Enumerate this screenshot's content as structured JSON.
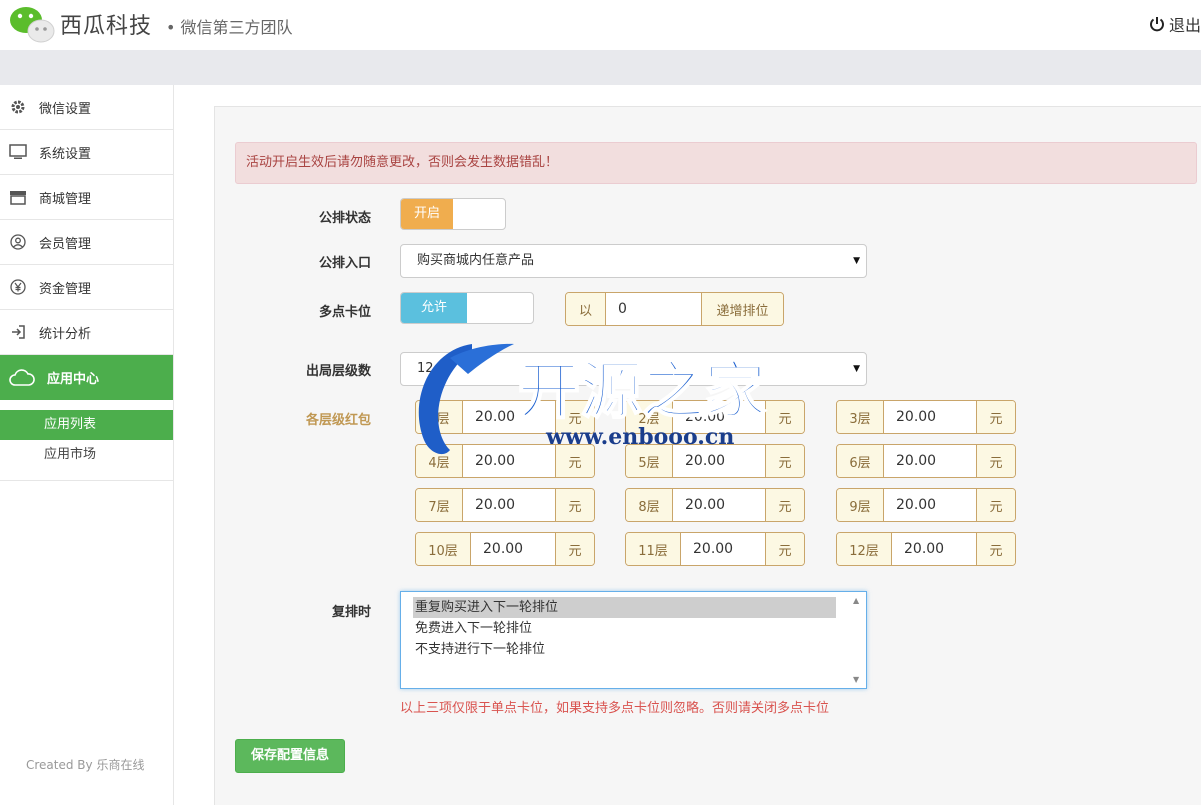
{
  "header": {
    "brand": "西瓜科技",
    "subtitle": "• 微信第三方团队",
    "logout_label": "退出"
  },
  "sidebar": {
    "items": [
      {
        "label": "微信设置",
        "icon": "gear-icon"
      },
      {
        "label": "系统设置",
        "icon": "monitor-icon"
      },
      {
        "label": "商城管理",
        "icon": "store-icon"
      },
      {
        "label": "会员管理",
        "icon": "user-icon"
      },
      {
        "label": "资金管理",
        "icon": "yen-icon"
      },
      {
        "label": "统计分析",
        "icon": "sign-in-icon"
      },
      {
        "label": "应用中心",
        "icon": "cloud-icon",
        "active": true
      }
    ],
    "subitems": [
      {
        "label": "应用列表",
        "active": true
      },
      {
        "label": "应用市场"
      }
    ],
    "footer": "Created By 乐商在线"
  },
  "alert": "活动开启生效后请勿随意更改，否则会发生数据错乱！",
  "form": {
    "status_label": "公排状态",
    "status_value": "开启",
    "entry_label": "公排入口",
    "entry_value": "购买商城内任意产品",
    "multi_label": "多点卡位",
    "multi_value": "允许",
    "multi_prefix": "以",
    "multi_input": "0",
    "multi_suffix": "递增排位",
    "levels_label": "出局层级数",
    "levels_value": "12",
    "layers_label": "各层级红包",
    "layers": [
      {
        "name": "1层",
        "value": "20.00",
        "unit": "元"
      },
      {
        "name": "2层",
        "value": "20.00",
        "unit": "元"
      },
      {
        "name": "3层",
        "value": "20.00",
        "unit": "元"
      },
      {
        "name": "4层",
        "value": "20.00",
        "unit": "元"
      },
      {
        "name": "5层",
        "value": "20.00",
        "unit": "元"
      },
      {
        "name": "6层",
        "value": "20.00",
        "unit": "元"
      },
      {
        "name": "7层",
        "value": "20.00",
        "unit": "元"
      },
      {
        "name": "8层",
        "value": "20.00",
        "unit": "元"
      },
      {
        "name": "9层",
        "value": "20.00",
        "unit": "元"
      },
      {
        "name": "10层",
        "value": "20.00",
        "unit": "元"
      },
      {
        "name": "11层",
        "value": "20.00",
        "unit": "元"
      },
      {
        "name": "12层",
        "value": "20.00",
        "unit": "元"
      }
    ],
    "repeat_label": "复排时",
    "repeat_options": [
      "重复购买进入下一轮排位",
      "免费进入下一轮排位",
      "不支持进行下一轮排位"
    ],
    "note": "以上三项仅限于单点卡位，如果支持多点卡位则忽略。否则请关闭多点卡位",
    "save_label": "保存配置信息"
  },
  "watermark": {
    "title": "开源之家",
    "url": "www.enbooo.cn"
  },
  "colors": {
    "green": "#4cae4c",
    "orange_toggle": "#f0ad4e",
    "blue_toggle": "#5bc0de",
    "alert_bg": "#f2dede",
    "alert_text": "#a94442",
    "note_red": "#d9534f"
  }
}
